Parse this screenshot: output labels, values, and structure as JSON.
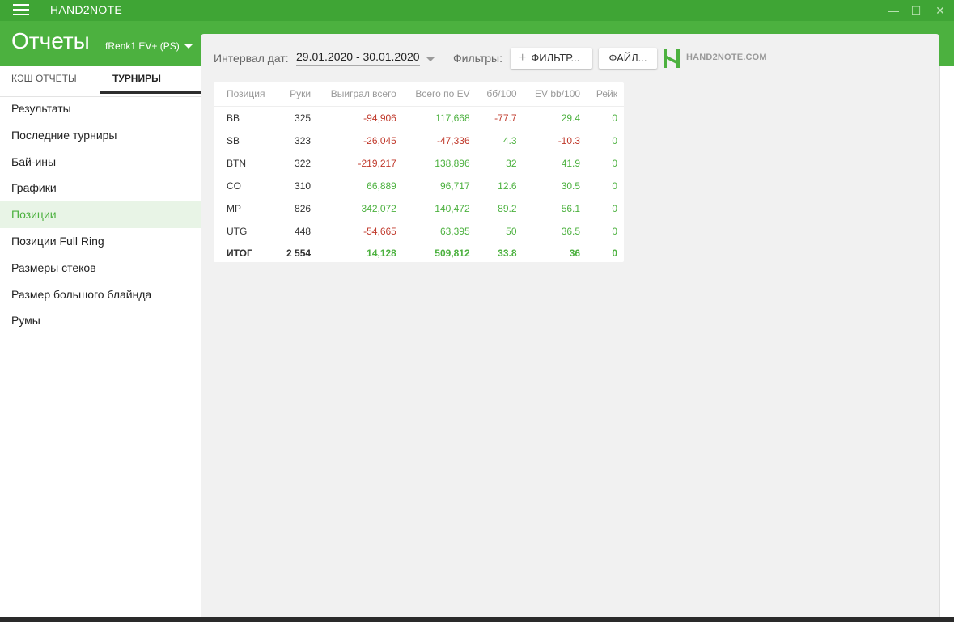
{
  "app": {
    "title": "HAND2NOTE"
  },
  "window": {
    "minimize": "—",
    "maximize": "☐",
    "close": "✕"
  },
  "header": {
    "title": "Отчеты",
    "player": "fRenk1 EV+ (PS)"
  },
  "sidebar": {
    "tabs": [
      {
        "label": "КЭШ ОТЧЕТЫ"
      },
      {
        "label": "ТУРНИРЫ",
        "active": true
      }
    ],
    "items": [
      {
        "label": "Результаты"
      },
      {
        "label": "Последние турниры"
      },
      {
        "label": "Бай-ины"
      },
      {
        "label": "Графики"
      },
      {
        "label": "Позиции",
        "active": true
      },
      {
        "label": "Позиции Full Ring"
      },
      {
        "label": "Размеры стеков"
      },
      {
        "label": "Размер большого блайнда"
      },
      {
        "label": "Румы"
      }
    ]
  },
  "toolbar": {
    "interval_label": "Интервал дат:",
    "date_range": "29.01.2020 - 30.01.2020",
    "filters_label": "Фильтры:",
    "filter_button": "ФИЛЬТР...",
    "file_button": "ФАЙЛ...",
    "logo_text": "HAND2NOTE.COM"
  },
  "table": {
    "headers": [
      "Позиция",
      "Руки",
      "Выиграл всего",
      "Всего по EV",
      "бб/100",
      "EV bb/100",
      "Рейк"
    ],
    "rows": [
      [
        "BB",
        "325",
        "-94,906",
        "117,668",
        "-77.7",
        "29.4",
        "0"
      ],
      [
        "SB",
        "323",
        "-26,045",
        "-47,336",
        "4.3",
        "-10.3",
        "0"
      ],
      [
        "BTN",
        "322",
        "-219,217",
        "138,896",
        "32",
        "41.9",
        "0"
      ],
      [
        "CO",
        "310",
        "66,889",
        "96,717",
        "12.6",
        "30.5",
        "0"
      ],
      [
        "MP",
        "826",
        "342,072",
        "140,472",
        "89.2",
        "56.1",
        "0"
      ],
      [
        "UTG",
        "448",
        "-54,665",
        "63,395",
        "50",
        "36.5",
        "0"
      ]
    ],
    "total": [
      "ИТОГ",
      "2 554",
      "14,128",
      "509,812",
      "33.8",
      "36",
      "0"
    ]
  },
  "colors": {
    "brand_green": "#4cb13f",
    "titlebar_green": "#3fa535",
    "negative": "#c0392b"
  }
}
